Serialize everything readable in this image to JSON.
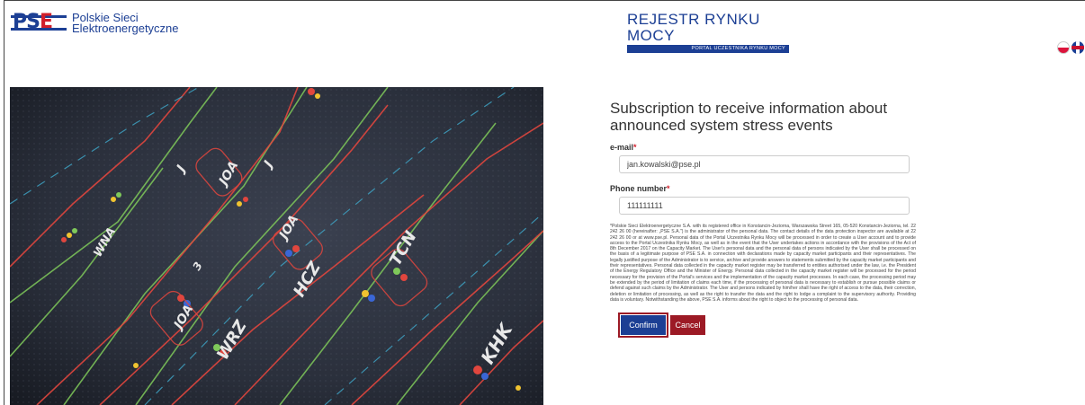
{
  "header": {
    "logo_mark_ps": "PS",
    "logo_mark_e": "E",
    "company_line1": "Polskie Sieci",
    "company_line2": "Elektroenergetyczne",
    "register_title": "REJESTR RYNKU MOCY",
    "register_subtitle": "PORTAL UCZESTNIKA RYNKU MOCY"
  },
  "languages": [
    {
      "code": "pl",
      "icon": "poland-flag-icon"
    },
    {
      "code": "en",
      "icon": "uk-flag-icon"
    }
  ],
  "hero": {
    "labels": [
      "J",
      "WNA",
      "JOA",
      "J",
      "JOA",
      "HCZ",
      "TCN",
      "WRZ",
      "KHK",
      "JOA",
      "3"
    ]
  },
  "form": {
    "title": "Subscription to receive information about announced system stress events",
    "email_label": "e-mail",
    "email_value": "jan.kowalski@pse.pl",
    "phone_label": "Phone number",
    "phone_value": "111111111",
    "required_mark": "*",
    "legal_text": "*Polskie Sieci Elektroenergetyczne S.A. with its registered office in Konstancin-Jeziorna, Warszawska Street 165, 05-520 Konstancin-Jeziorna, tel. 22 242 26 00 (hereinafter: „PSE S.A.\") is the administrator of the personal data. The contact details of the data protection inspector are available at 22 242 26 00 or at www.pse.pl. Personal data of the Portal Uczestnika Rynku Mocy will be processed in order to create a User account and to provide access to the Portal Uczestnika Rynku Mocy, as well as in the event that the User undertakes actions in accordance with the provisions of the Act of 8th December 2017 on the Capacity Market. The User's personal data and the personal data of persons indicated by the User shall be processed on the basis of a legitimate purpose of PSE S.A. in connection with declarations made by capacity market participants and their representatives. The legally justified purpose of the Administrator is to service, archive and provide answers to statements submitted by the capacity market participants and their representatives. Personal data collected in the capacity market register may be transferred to entities authorised under the law, i.e. the President of the Energy Regulatory Office and the Minister of Energy. Personal data collected in the capacity market register will be processed for the period necessary for the provision of the Portal's services and the implementation of the capacity market processes. In each case, the processing period may be extended by the period of limitation of claims each time, if the processing of personal data is necessary to establish or pursue possible claims or defend against such claims by the Administrator. The User and persons indicated by him/her shall have the right of access to the data, their correction, deletion or limitation of processing, as well as the right to transfer the data and the right to lodge a complaint to the supervisory authority. Providing data is voluntary. Notwithstanding the above, PSE S.A. informs about the right to object to the processing of personal data.",
    "confirm_label": "Confirm",
    "cancel_label": "Cancel"
  },
  "colors": {
    "brand_blue": "#1c3f94",
    "brand_red": "#d11f2b",
    "cancel_red": "#9c1a25"
  }
}
